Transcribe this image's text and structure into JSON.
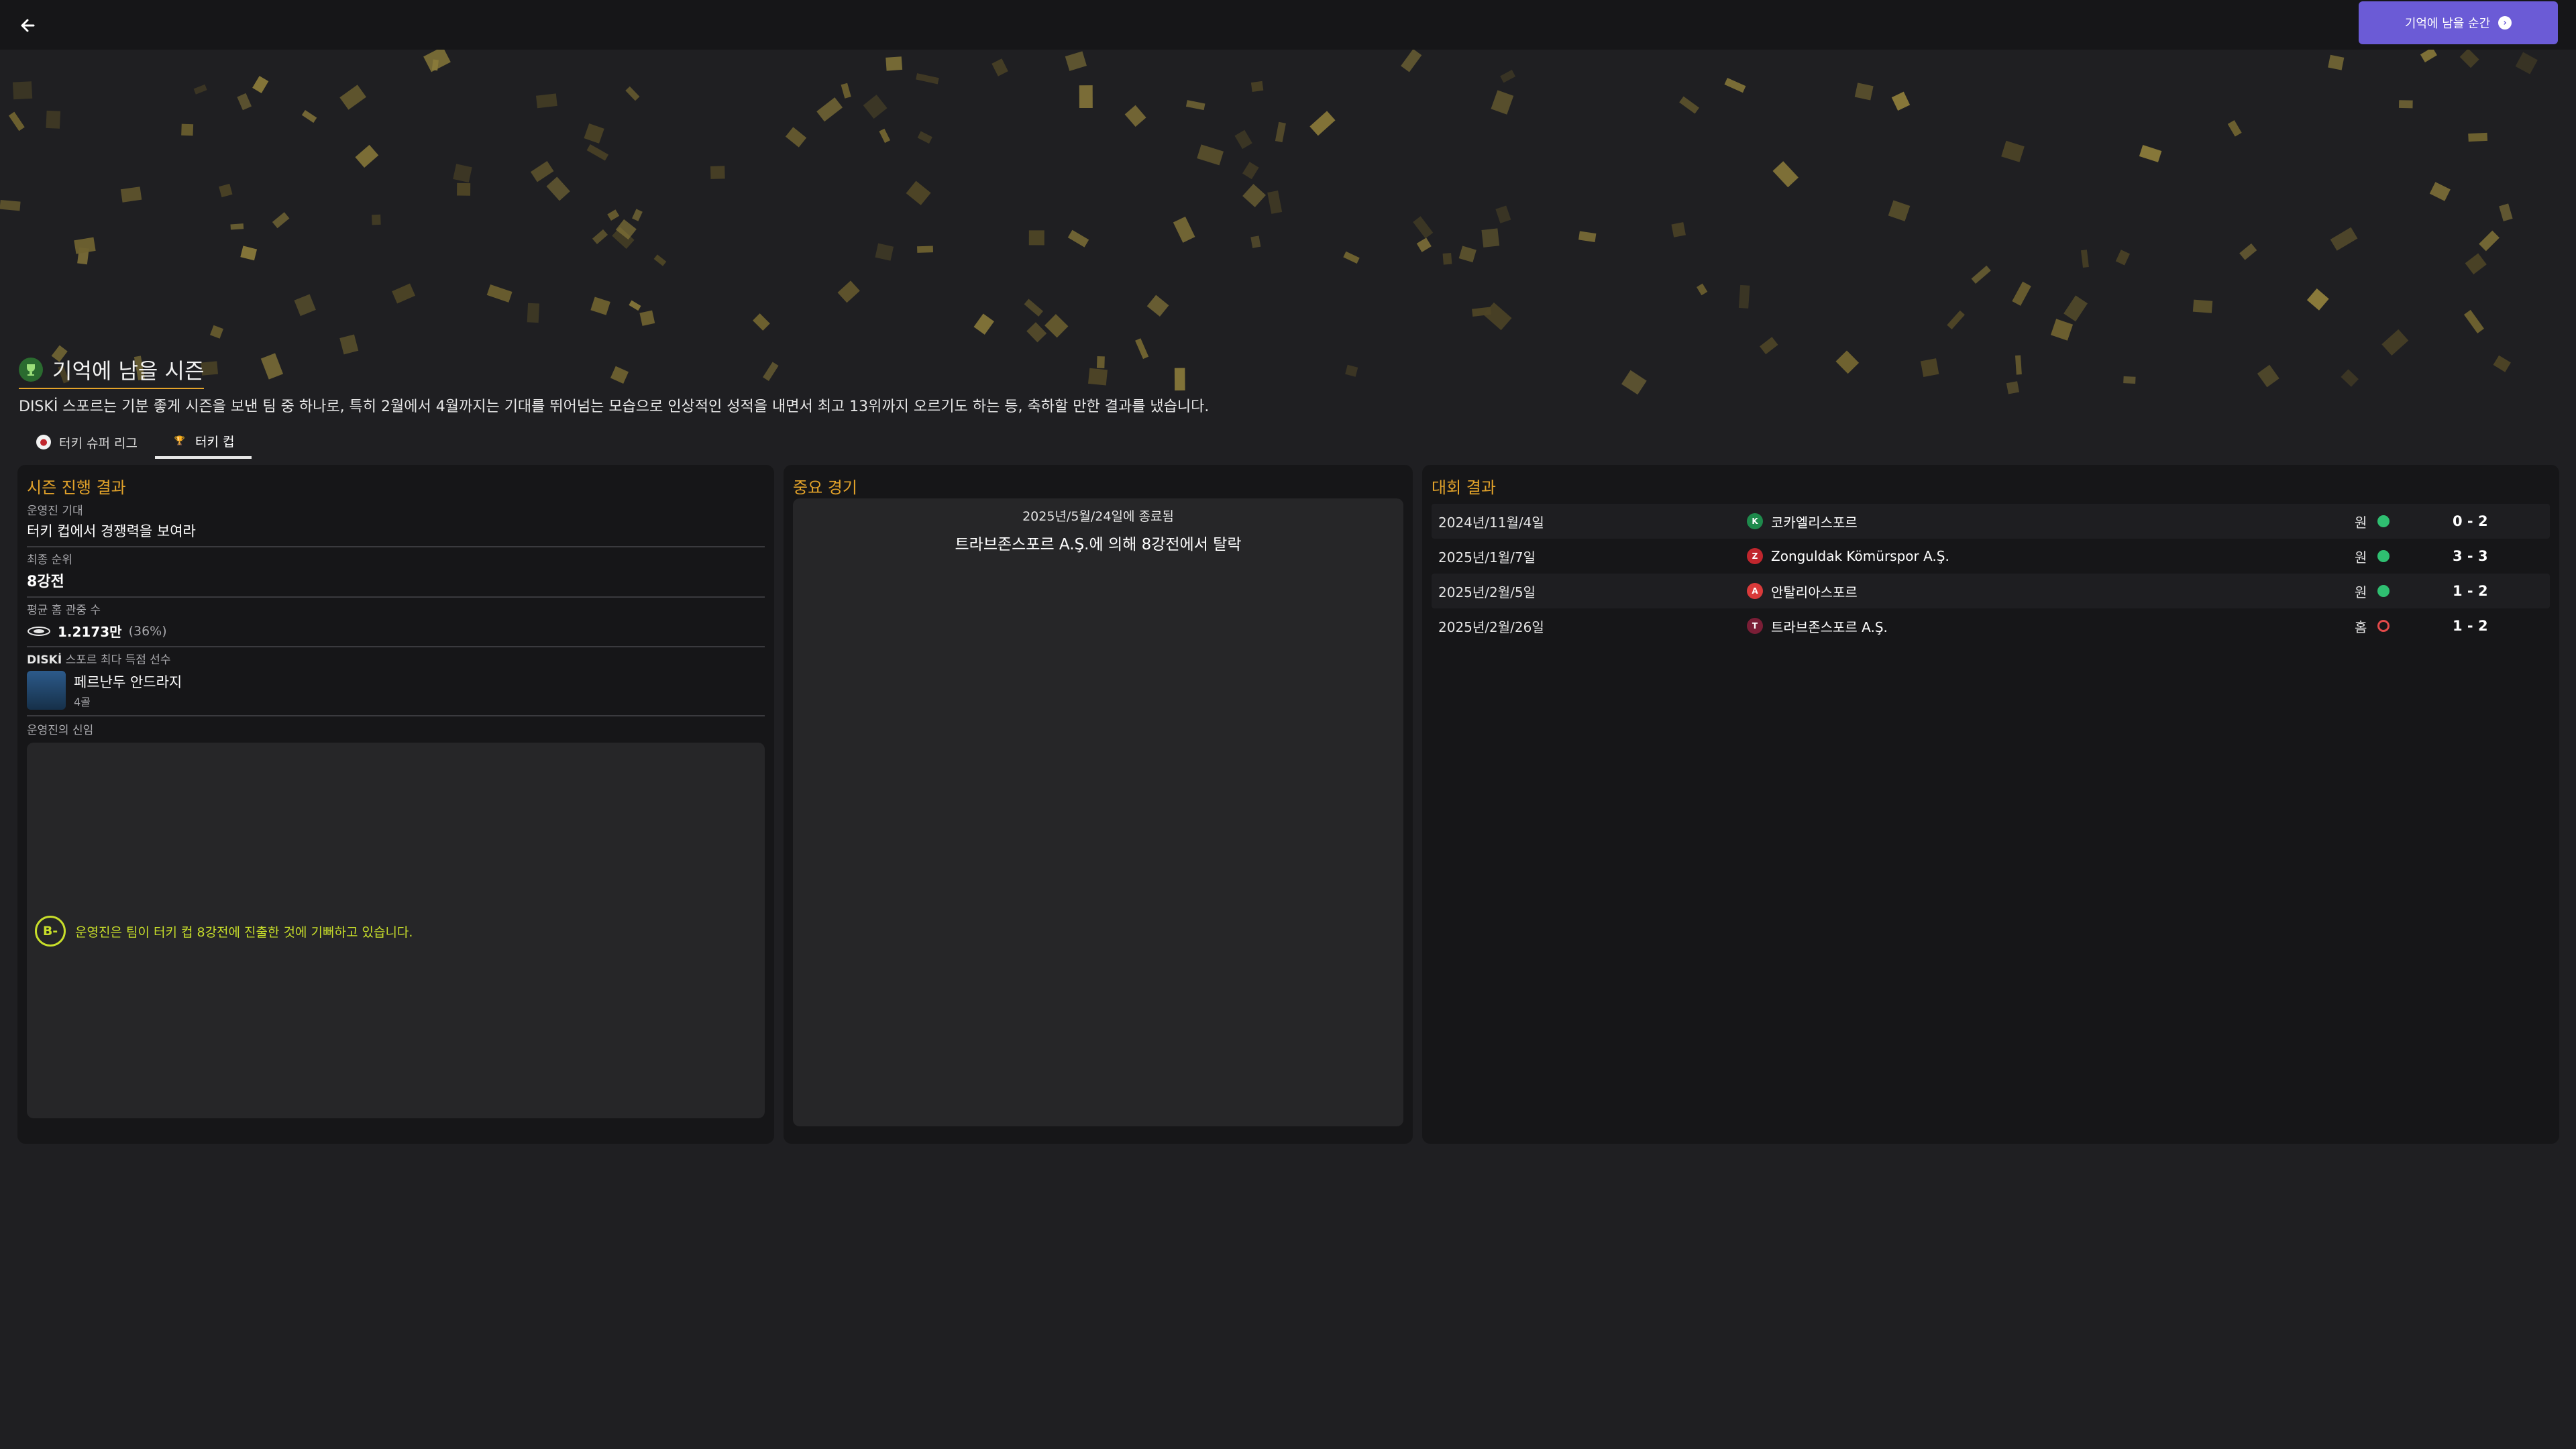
{
  "topbar": {
    "back_icon": "arrow-left-icon",
    "primary_button_label": "기억에 남을 순간"
  },
  "header": {
    "title": "기억에 남을 시즌",
    "description": "DISKİ 스포르는 기분 좋게 시즌을 보낸 팀 중 하나로, 특히 2월에서 4월까지는 기대를 뛰어넘는 모습으로 인상적인 성적을 내면서 최고 13위까지 오르기도 하는 등, 축하할 만한 결과를 냈습니다."
  },
  "tabs": [
    {
      "label": "터키 슈퍼 리그",
      "icon": "league-icon",
      "active": false
    },
    {
      "label": "터키 컵",
      "icon": "cup-icon",
      "active": true
    }
  ],
  "season_progress": {
    "title": "시즌 진행 결과",
    "expectation_label": "운영진 기대",
    "expectation_value": "터키 컵에서 경쟁력을 보여라",
    "final_rank_label": "최종 순위",
    "final_rank_value": "8강전",
    "attendance_label": "평균 홈 관중 수",
    "attendance_value": "1.2173만",
    "attendance_pct": "(36%)",
    "top_scorer_label_prefix": "DISKİ",
    "top_scorer_label_suffix": "스포르 최다 득점 선수",
    "top_scorer_name": "페르난두 안드라지",
    "top_scorer_goals": "4골",
    "board_label": "운영진의 신임",
    "board_grade": "B-",
    "board_comment": "운영진은 팀이 터키 컵 8강전에 진출한 것에 기뻐하고 있습니다."
  },
  "key_match": {
    "title": "중요 경기",
    "date": "2025년/5월/24일에 종료됨",
    "event": "트라브존스포르 A.Ş.에 의해 8강전에서 탈락"
  },
  "competition_results": {
    "title": "대회 결과",
    "rows": [
      {
        "date": "2024년/11월/4일",
        "team": "코카엘리스포르",
        "venue": "원",
        "result": "win",
        "score": "0 - 2",
        "crest_color": "#1e8a4c"
      },
      {
        "date": "2025년/1월/7일",
        "team": "Zonguldak Kömürspor A.Ş.",
        "venue": "원",
        "result": "win",
        "score": "3 - 3",
        "crest_color": "#c0262d"
      },
      {
        "date": "2025년/2월/5일",
        "team": "안탈리아스포르",
        "venue": "원",
        "result": "win",
        "score": "1 - 2",
        "crest_color": "#d93a3a"
      },
      {
        "date": "2025년/2월/26일",
        "team": "트라브존스포르 A.Ş.",
        "venue": "홈",
        "result": "loss",
        "score": "1 - 2",
        "crest_color": "#7a1e36"
      }
    ]
  },
  "colors": {
    "accent_gold": "#e3a32a",
    "primary_button": "#6b5bd6",
    "win": "#2fbf71",
    "loss": "#e24a4a",
    "grade": "#c8de2a"
  }
}
